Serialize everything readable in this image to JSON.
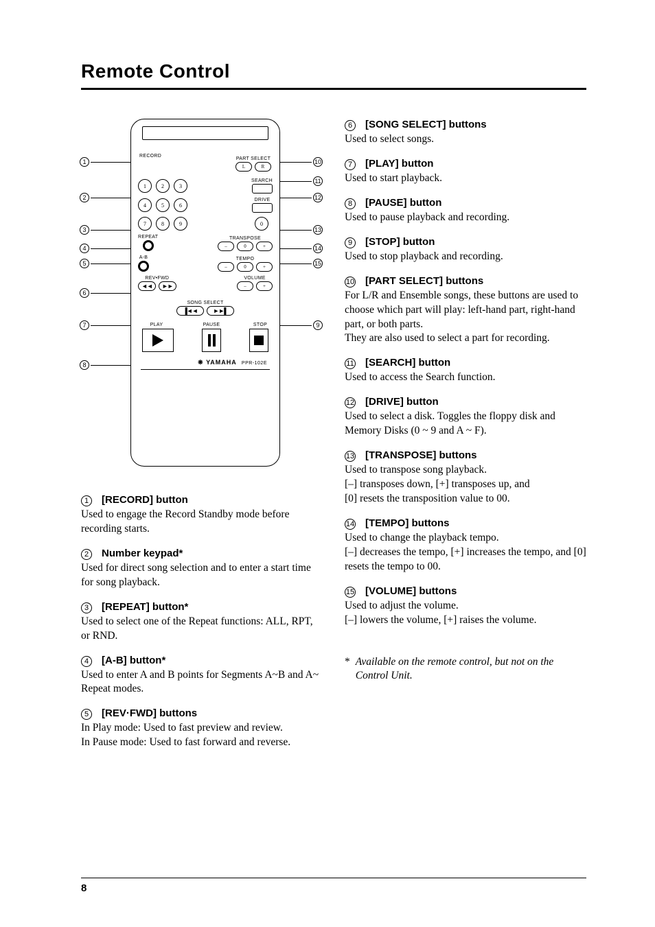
{
  "page": {
    "title": "Remote Control",
    "number": "8"
  },
  "remote": {
    "labels": {
      "record": "RECORD",
      "part_select": "PART SELECT",
      "part_l": "L",
      "part_r": "R",
      "search": "SEARCH",
      "drive": "DRIVE",
      "repeat": "REPEAT",
      "transpose": "TRANSPOSE",
      "ab": "A-B",
      "tempo": "TEMPO",
      "revfwd": "REV•FWD",
      "volume": "VOLUME",
      "song_select": "SONG SELECT",
      "play": "PLAY",
      "pause": "PAUSE",
      "stop": "STOP",
      "brand": "YAMAHA",
      "model": "PPR-102E",
      "minus": "–",
      "zero": "0",
      "plus": "+",
      "num1": "1",
      "num2": "2",
      "num3": "3",
      "num4": "4",
      "num5": "5",
      "num6": "6",
      "num7": "7",
      "num8": "8",
      "num9": "9",
      "num0": "0",
      "rev": "◄◄",
      "fwd": "►►",
      "skip_prev": "▐◄◄",
      "skip_next": "►►▌"
    }
  },
  "callouts_left": [
    "1",
    "2",
    "3",
    "4",
    "5",
    "6",
    "7",
    "8"
  ],
  "callouts_right": [
    "10",
    "11",
    "12",
    "13",
    "14",
    "15",
    "9"
  ],
  "items_left": [
    {
      "num": "1",
      "title": "[RECORD] button",
      "body": "Used to engage the Record Standby mode before recording starts."
    },
    {
      "num": "2",
      "title": "Number keypad*",
      "body": "Used for direct song selection and to enter a start time for song playback."
    },
    {
      "num": "3",
      "title": "[REPEAT] button*",
      "body": "Used to select one of the Repeat functions: ALL, RPT, or RND."
    },
    {
      "num": "4",
      "title": "[A-B] button*",
      "body": "Used to enter A and B points for Segments A~B and A~ Repeat modes."
    },
    {
      "num": "5",
      "title": "[REV·FWD] buttons",
      "body": "In Play mode: Used to fast preview and review.\nIn Pause mode: Used to fast forward and reverse."
    }
  ],
  "items_right": [
    {
      "num": "6",
      "title": "[SONG SELECT] buttons",
      "body": "Used to select songs."
    },
    {
      "num": "7",
      "title": "[PLAY] button",
      "body": "Used to start playback."
    },
    {
      "num": "8",
      "title": "[PAUSE] button",
      "body": "Used to pause playback and recording."
    },
    {
      "num": "9",
      "title": "[STOP] button",
      "body": "Used to stop playback and recording."
    },
    {
      "num": "10",
      "title": "[PART SELECT] buttons",
      "body": "For L/R and Ensemble songs, these buttons are used to choose which part will play: left-hand part, right-hand part, or both parts.\nThey are also used to select a part for recording."
    },
    {
      "num": "11",
      "title": "[SEARCH] button",
      "body": "Used to access the Search function."
    },
    {
      "num": "12",
      "title": "[DRIVE] button",
      "body": "Used to select a disk.  Toggles the floppy disk and Memory Disks (0 ~ 9 and A ~ F)."
    },
    {
      "num": "13",
      "title": "[TRANSPOSE] buttons",
      "body": "Used to transpose song playback.\n[–] transposes down, [+] transposes up, and\n[0] resets the transposition value to 00."
    },
    {
      "num": "14",
      "title": "[TEMPO] buttons",
      "body": "Used to change the playback tempo.\n[–] decreases the tempo, [+] increases the tempo, and [0] resets the tempo to 00."
    },
    {
      "num": "15",
      "title": "[VOLUME] buttons",
      "body": "Used to adjust the volume.\n[–] lowers the volume, [+] raises the volume."
    }
  ],
  "footnote": {
    "marker": "*",
    "text": "Available on the remote control, but not on the Control Unit."
  }
}
